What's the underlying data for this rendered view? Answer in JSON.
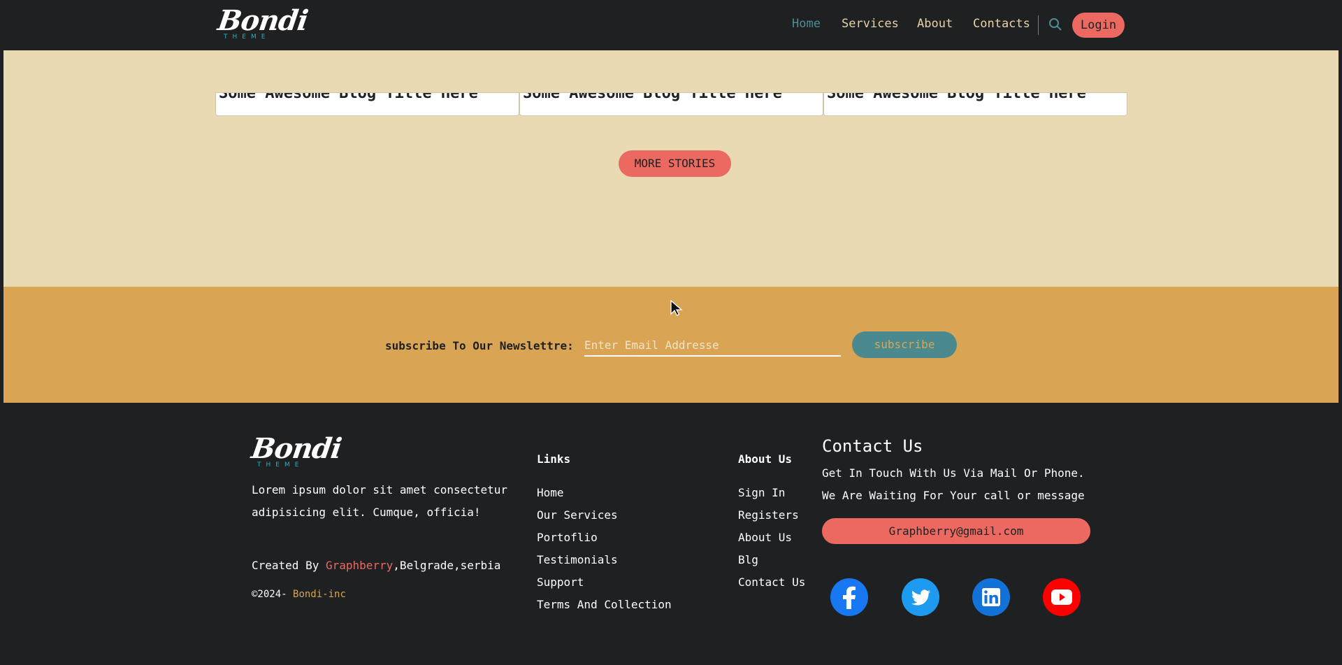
{
  "header": {
    "logo_text": "Bondi",
    "logo_sub": "THEME",
    "nav": [
      "Home",
      "Services",
      "About",
      "Contacts"
    ],
    "login_label": "Login",
    "search_icon": "search-icon"
  },
  "blog": {
    "cards": [
      "Some Awesome Blog Title Here",
      "Some Awesome Blog Title Here",
      "Some Awesome Blog Title Here"
    ],
    "more_label": "MORE STORIES"
  },
  "newsletter": {
    "label": "subscribe To Our Newslettre:",
    "placeholder": "Enter Email Addresse",
    "button_label": "subscribe"
  },
  "footer": {
    "logo_text": "Bondi",
    "logo_sub": "THEME",
    "description_line1": "Lorem ipsum dolor sit amet consectetur",
    "description_line2": "adipisicing elit. Cumque, officia!",
    "created_prefix": "Created By ",
    "created_name": "Graphberry",
    "created_suffix": ",Belgrade,serbia",
    "copyright_prefix": "©2024- ",
    "copyright_name": "Bondi-inc",
    "links_heading": "Links",
    "links": [
      "Home",
      "Our Services",
      "Portoflio",
      "Testimonials",
      "Support",
      "Terms And Collection"
    ],
    "about_heading": "About Us",
    "about_links": [
      "Sign In",
      "Registers",
      "About Us",
      "Blg",
      "Contact Us"
    ],
    "contact_heading": "Contact Us",
    "contact_line1": "Get In Touch With Us Via Mail Or Phone.",
    "contact_line2": "We Are Waiting For Your call or message",
    "email": "Graphberry@gmail.com",
    "social": [
      "facebook-icon",
      "twitter-icon",
      "linkedin-icon",
      "youtube-icon"
    ]
  },
  "colors": {
    "dark": "#1e2022",
    "cream": "#e9dab3",
    "gold": "#d9a555",
    "coral": "#eb6960",
    "teal": "#4f8d95"
  }
}
